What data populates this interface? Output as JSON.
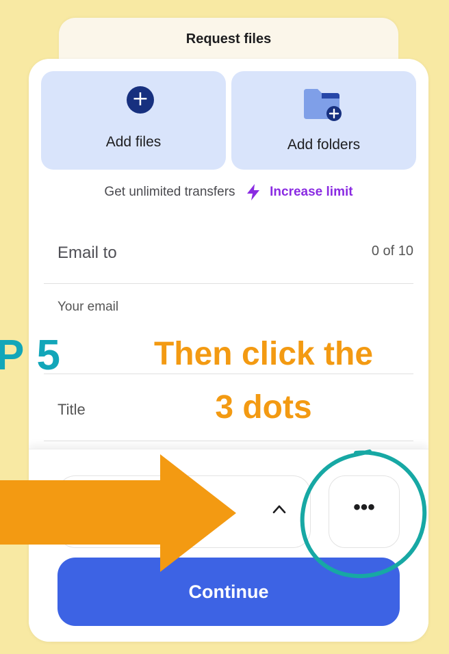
{
  "request_tab": {
    "title": "Request files"
  },
  "tiles": {
    "add_files_label": "Add files",
    "add_folders_label": "Add folders",
    "plus_symbol": "+"
  },
  "promo": {
    "text": "Get unlimited transfers",
    "link": "Increase limit"
  },
  "fields": {
    "email_to_label": "Email to",
    "email_to_counter": "0 of 10",
    "your_email_label": "Your email",
    "title_label": "Title"
  },
  "footer": {
    "more_label": "•••",
    "continue_label": "Continue"
  },
  "overlay": {
    "step_label": "P 5",
    "callout_line_1": "Then click the",
    "callout_line_2": "3 dots"
  },
  "colors": {
    "page_background": "#f8e9a3",
    "tile_background": "#d9e4fb",
    "primary_button": "#3d63e4",
    "link_purple": "#8a2be2",
    "callout_orange": "#f39a12",
    "step_teal": "#12a6b9",
    "plus_circle_navy": "#17307f"
  },
  "icons": {
    "add_files": "plus-circle-icon",
    "add_folders": "folder-plus-icon",
    "promo": "lightning-bolt-icon",
    "select": "chevron-up-icon",
    "more": "more-dots-icon"
  }
}
